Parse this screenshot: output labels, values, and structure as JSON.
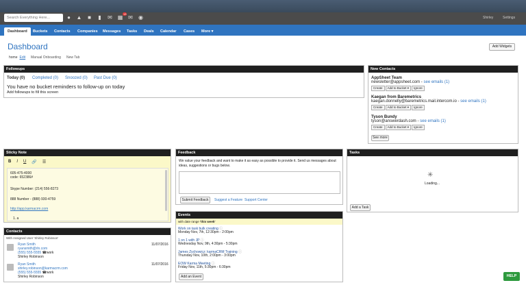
{
  "search": {
    "placeholder": "Search Everything Here..."
  },
  "topbar": {
    "notif_count": "13",
    "user": "Shirley",
    "settings": "Settings"
  },
  "nav": {
    "tabs": [
      "Dashboard",
      "Buckets",
      "Contacts",
      "Companies",
      "Messages",
      "Tasks",
      "Deals",
      "Calendar",
      "Cases",
      "More ▾"
    ]
  },
  "page": {
    "title": "Dashboard",
    "add_widgets": "Add Widgets"
  },
  "subnav": {
    "home": "home",
    "edit": "Edit",
    "tabs": [
      "Manual Onboarding",
      "New Tab"
    ]
  },
  "followups": {
    "title": "Followups",
    "tabs": [
      "Today (0)",
      "Completed (0)",
      "Snoozed (0)",
      "Past Due (0)"
    ],
    "empty_title": "You have no bucket reminders to follow-up on today",
    "empty_sub": "Add followups to fill this screen"
  },
  "new_contacts": {
    "title": "New Contacts",
    "items": [
      {
        "name": "AppSheet Team",
        "email": "newsletter@appsheet.com",
        "see": "see emails (1)"
      },
      {
        "name": "Kaegan from Baremetrics",
        "email": "kaegan.donnelly@baremetrics.mail.intercom.io",
        "see": "see emails (1)"
      },
      {
        "name": "Tyson Bundy",
        "email": "tyson@answerdash.com",
        "see": "see emails (1)"
      }
    ],
    "buttons": {
      "create": "Create",
      "add": "Add to Bucket ▾",
      "ignore": "Ignore"
    },
    "see_more": "See more"
  },
  "sticky": {
    "title": "Sticky Note",
    "tools": [
      "B",
      "I",
      "U",
      "🔗",
      "☰"
    ],
    "lines": [
      "605-475-4000",
      "code: 652386#",
      "",
      "Skype Number: (214) 556-8273",
      "",
      "888 Number - (888) 930-4759",
      "",
      "http://app.karmacrm.com",
      "",
      "1. a"
    ]
  },
  "feedback": {
    "title": "Feedback",
    "text": "We value your feedback and want to make it as easy as possible to provide it. Send us messages about ideas, suggestions or bugs below.",
    "submit": "Submit Feedback",
    "suggest": "Suggest a Feature",
    "support": "Support Center"
  },
  "tasks": {
    "title": "Tasks",
    "loading": "Loading...",
    "add": "Add a Task"
  },
  "contacts": {
    "title": "Contacts",
    "filter": "With Assigned User 'Shirley Robinson'",
    "items": [
      {
        "name": "Ryan Smith",
        "email": "ryansmith@rln.com",
        "phone": "(555) 555-5555",
        "tag": "work",
        "owner": "Shirley Robinson",
        "date": "11/07/2016"
      },
      {
        "name": "Ryan Smith",
        "email": "shirley.robinson@karmacrm.com",
        "phone": "(555) 555-5555",
        "tag": "work",
        "owner": "Shirley Robinson",
        "date": "11/07/2016"
      }
    ]
  },
  "events": {
    "title": "Events",
    "range_prefix": "with date range",
    "range": "'this week'",
    "items": [
      {
        "name": "Work on task bulk creating",
        "when": "Monday Nov, 7th, 12:30pm - 2:00pm"
      },
      {
        "name": "1 on 1 with JP",
        "when": "Wednesday Nov, 9th, 4:30pm - 5:30pm"
      },
      {
        "name": "James Zychowicz: karmaCRM Training",
        "when": "Thursday Nov, 10th, 2:00pm - 3:00pm"
      },
      {
        "name": "EOW Karma Meeting",
        "when": "Friday Nov, 11th, 5:30pm - 6:30pm"
      }
    ],
    "add": "Add an Event"
  },
  "help": "HELP"
}
